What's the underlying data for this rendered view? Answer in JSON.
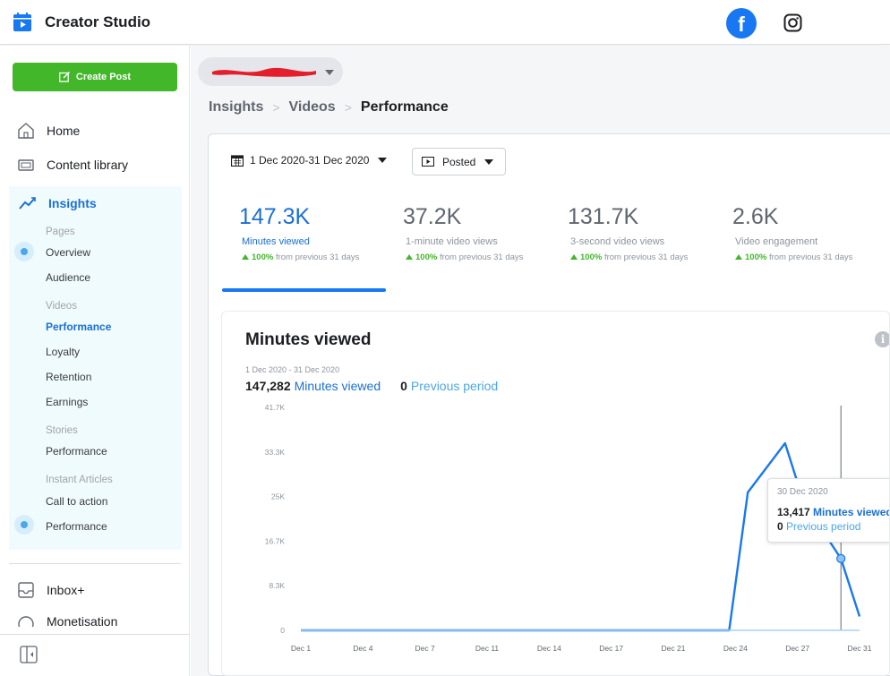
{
  "app": {
    "title": "Creator Studio"
  },
  "sidebar": {
    "create_post": "Create Post",
    "home": "Home",
    "content_library": "Content library",
    "insights": "Insights",
    "groups": [
      {
        "label": "Pages",
        "items": [
          "Overview",
          "Audience"
        ]
      },
      {
        "label": "Videos",
        "items": [
          "Performance",
          "Loyalty",
          "Retention",
          "Earnings"
        ]
      },
      {
        "label": "Stories",
        "items": [
          "Performance"
        ]
      },
      {
        "label": "Instant Articles",
        "items": [
          "Call to action",
          "Performance"
        ]
      }
    ],
    "inbox": "Inbox+",
    "monetisation": "Monetisation"
  },
  "breadcrumb": {
    "items": [
      "Insights",
      "Videos",
      "Performance"
    ]
  },
  "filters": {
    "date_range": "1 Dec 2020-31 Dec 2020",
    "posted": "Posted"
  },
  "metrics": [
    {
      "value": "147.3K",
      "label": "Minutes viewed",
      "change": "100%",
      "change_text": " from previous 31 days"
    },
    {
      "value": "37.2K",
      "label": "1-minute video views",
      "change": "100%",
      "change_text": " from previous 31 days"
    },
    {
      "value": "131.7K",
      "label": "3-second video views",
      "change": "100%",
      "change_text": " from previous 31 days"
    },
    {
      "value": "2.6K",
      "label": "Video engagement",
      "change": "100%",
      "change_text": " from previous 31 days"
    }
  ],
  "chart": {
    "title": "Minutes viewed",
    "range": "1 Dec 2020 - 31 Dec 2020",
    "legend": [
      {
        "value": "147,282",
        "name": "Minutes viewed"
      },
      {
        "value": "0",
        "name": "Previous period"
      }
    ],
    "tooltip": {
      "date": "30 Dec 2020",
      "value1": "13,417",
      "name1": "Minutes viewed",
      "value2": "0",
      "name2": "Previous period"
    }
  },
  "chart_data": {
    "type": "line",
    "title": "Minutes viewed",
    "xlabel": "",
    "ylabel": "",
    "x_ticks": [
      "Dec 1",
      "Dec 4",
      "Dec 7",
      "Dec 11",
      "Dec 14",
      "Dec 17",
      "Dec 21",
      "Dec 24",
      "Dec 27",
      "Dec 31"
    ],
    "y_ticks": [
      "0",
      "8.3K",
      "16.7K",
      "25K",
      "33.3K",
      "41.7K"
    ],
    "ylim": [
      0,
      41700
    ],
    "x_days": [
      1,
      24,
      25,
      27,
      28,
      30,
      31
    ],
    "series": [
      {
        "name": "Minutes viewed",
        "color": "#1877f2",
        "values": [
          0,
          0,
          25800,
          35000,
          24000,
          13417,
          2600
        ]
      },
      {
        "name": "Previous period",
        "color": "#a8d0f5",
        "values": [
          0,
          0,
          0,
          0,
          0,
          0,
          0
        ]
      }
    ],
    "highlight_day": 30,
    "grid": false,
    "legend_position": "top-left"
  }
}
